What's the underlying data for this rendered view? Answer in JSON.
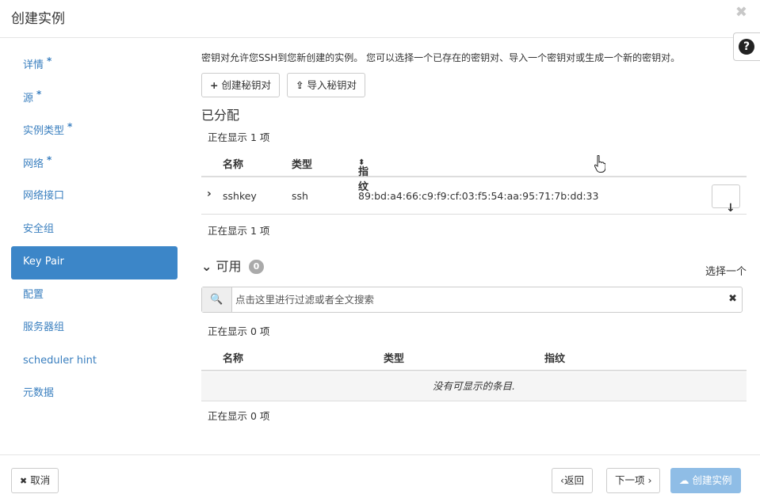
{
  "header": {
    "title": "创建实例",
    "close_glyph": "✖"
  },
  "help": {
    "glyph": "?"
  },
  "sidebar": {
    "items": [
      {
        "label": "详情",
        "required": "*"
      },
      {
        "label": "源",
        "required": "*"
      },
      {
        "label": "实例类型",
        "required": "*"
      },
      {
        "label": "网络",
        "required": "*"
      },
      {
        "label": "网络接口",
        "required": ""
      },
      {
        "label": "安全组",
        "required": ""
      },
      {
        "label": "Key Pair",
        "required": ""
      },
      {
        "label": "配置",
        "required": ""
      },
      {
        "label": "服务器组",
        "required": ""
      },
      {
        "label": "scheduler hint",
        "required": ""
      },
      {
        "label": "元数据",
        "required": ""
      }
    ],
    "active": "Key Pair"
  },
  "main": {
    "description": "密钥对允许您SSH到您新创建的实例。 您可以选择一个已存在的密钥对、导入一个密钥对或生成一个新的密钥对。",
    "create_btn": "创建秘钥对",
    "import_btn": "导入秘钥对",
    "allocated": {
      "title": "已分配",
      "count_top": "正在显示 1 项",
      "count_bottom": "正在显示 1 项",
      "columns": {
        "name": "名称",
        "type": "类型",
        "fingerprint": "指纹"
      },
      "rows": [
        {
          "name": "sshkey",
          "type": "ssh",
          "fingerprint": "89:bd:a4:66:c9:f9:cf:03:f5:54:aa:95:71:7b:dd:33"
        }
      ]
    },
    "available": {
      "title": "可用",
      "badge": "0",
      "select_one": "选择一个",
      "search_placeholder": "点击这里进行过滤或者全文搜索",
      "count_top": "正在显示 0 项",
      "count_bottom": "正在显示 0 项",
      "columns": {
        "name": "名称",
        "type": "类型",
        "fingerprint": "指纹"
      },
      "empty_text": "没有可显示的条目."
    }
  },
  "footer": {
    "cancel": "取消",
    "back": "‹返回",
    "next": "下一项 ›",
    "create": "创建实例"
  },
  "icons": [
    "close-icon",
    "help-icon",
    "plus-icon",
    "upload-icon",
    "chevron-right-icon",
    "sort-icon",
    "download-icon",
    "chevron-down-icon",
    "search-icon",
    "clear-icon",
    "cancel-icon",
    "cloud-upload-icon",
    "pointer-cursor-icon"
  ]
}
